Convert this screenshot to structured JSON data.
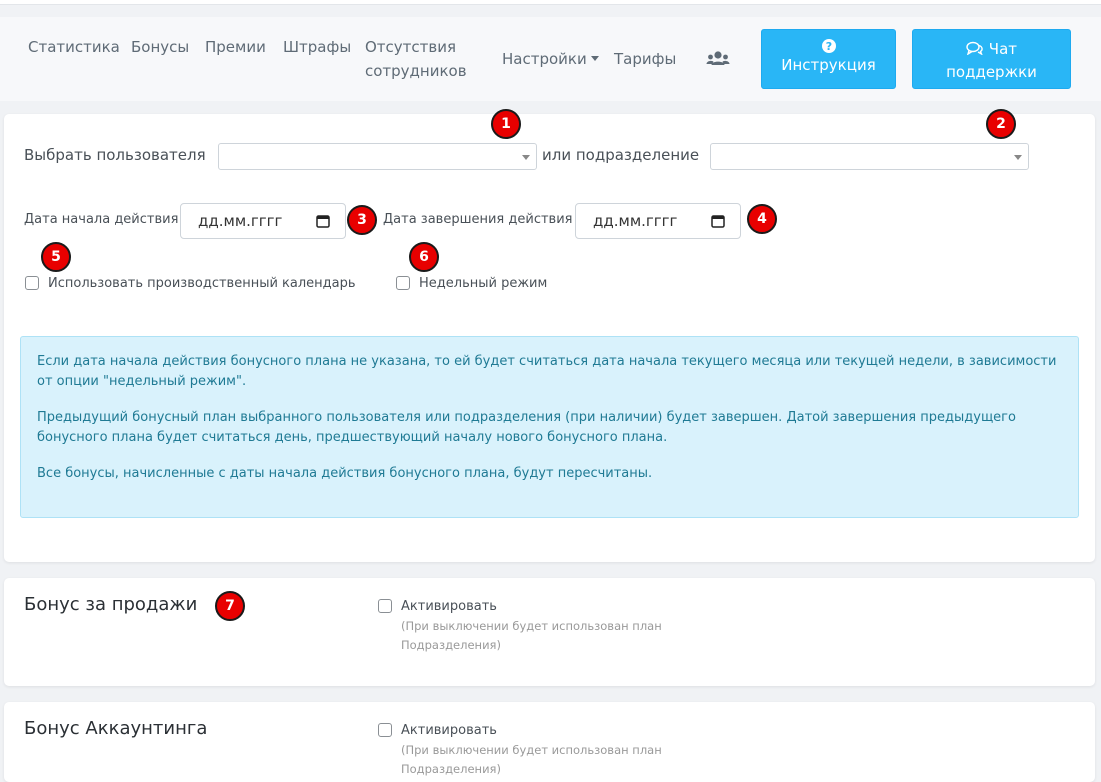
{
  "nav": {
    "items": [
      "Статистика",
      "Бонусы",
      "Премии",
      "Штрафы",
      "Отсутствия",
      "сотрудников",
      "Настройки",
      "Тарифы"
    ],
    "users_icon": "users-icon",
    "instruction_button": "Инструкция",
    "chat_button_line1": "Чат",
    "chat_button_line2": "поддержки"
  },
  "badges": [
    "1",
    "2",
    "3",
    "4",
    "5",
    "6",
    "7"
  ],
  "form": {
    "select_user_label": "Выбрать пользователя",
    "or_department_label": "или подразделение",
    "user_select_value": "",
    "department_select_value": "",
    "start_date_label": "Дата начала действия",
    "start_date_placeholder": "дд.мм.гггг",
    "end_date_label": "Дата завершения действия",
    "end_date_placeholder": "дд.мм.гггг",
    "production_calendar_label": "Использовать производственный календарь",
    "weekly_mode_label": "Недельный режим",
    "production_calendar_checked": false,
    "weekly_mode_checked": false
  },
  "info": {
    "p1": "Если дата начала действия бонусного плана не указана, то ей будет считаться дата начала текущего месяца или текущей недели, в зависимости от опции \"недельный режим\".",
    "p2": "Предыдущий бонусный план выбранного пользователя или подразделения (при наличии) будет завершен. Датой завершения предыдущего бонусного плана будет считаться день, предшествующий началу нового бонусного плана.",
    "p3": "Все бонусы, начисленные с даты начала действия бонусного плана, будут пересчитаны."
  },
  "sections": [
    {
      "title": "Бонус за продажи",
      "activate_label": "Активировать",
      "hint_line1": "(При выключении будет использован план",
      "hint_line2": "Подразделения)",
      "checked": false
    },
    {
      "title": "Бонус Аккаунтинга",
      "activate_label": "Активировать",
      "hint_line1": "(При выключении будет использован план",
      "hint_line2": "Подразделения)",
      "checked": false
    }
  ],
  "colors": {
    "accent": "#29b6f6",
    "badge": "#e80000",
    "info_bg": "#d9f2fc",
    "info_text": "#1f7a94"
  }
}
